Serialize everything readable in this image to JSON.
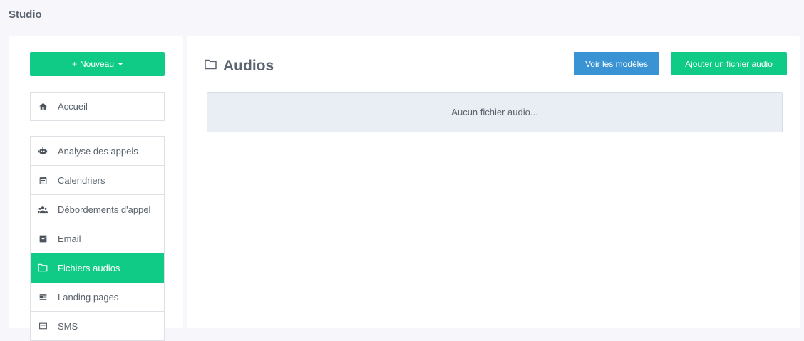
{
  "page": {
    "title": "Studio"
  },
  "sidebar": {
    "new_button": {
      "plus": "+",
      "label": "Nouveau"
    },
    "home": {
      "label": "Accueil",
      "icon": "home-icon"
    },
    "items": [
      {
        "label": "Analyse des appels",
        "icon": "robot-icon",
        "active": false
      },
      {
        "label": "Calendriers",
        "icon": "calendar-icon",
        "active": false
      },
      {
        "label": "Débordements d'appel",
        "icon": "people-icon",
        "active": false
      },
      {
        "label": "Email",
        "icon": "mail-icon",
        "active": false
      },
      {
        "label": "Fichiers audios",
        "icon": "folder-icon",
        "active": true
      },
      {
        "label": "Landing pages",
        "icon": "article-icon",
        "active": false
      },
      {
        "label": "SMS",
        "icon": "sms-icon",
        "active": false
      }
    ]
  },
  "main": {
    "title": "Audios",
    "title_icon": "folder-icon",
    "buttons": {
      "models": "Voir les modèles",
      "add": "Ajouter un fichier audio"
    },
    "empty_message": "Aucun fichier audio..."
  },
  "colors": {
    "accent_green": "#0fcb86",
    "accent_blue": "#3a93d3",
    "background": "#f7f7fb",
    "empty_box": "#e9eef4"
  }
}
